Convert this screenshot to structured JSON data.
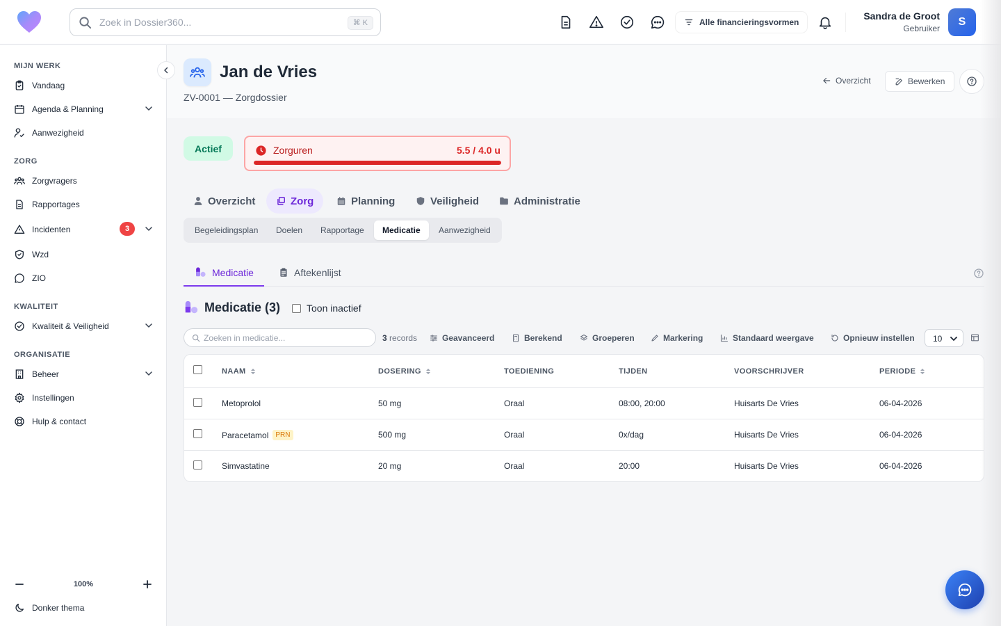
{
  "topbar": {
    "search_placeholder": "Zoek in Dossier360...",
    "search_shortcut": "⌘ K",
    "financing_label": "Alle financieringsvormen",
    "user_name": "Sandra de Groot",
    "user_role": "Gebruiker",
    "avatar_initial": "S"
  },
  "sidebar": {
    "sections": [
      {
        "title": "MIJN WERK",
        "items": [
          {
            "label": "Vandaag",
            "icon": "clipboard-check-icon"
          },
          {
            "label": "Agenda & Planning",
            "icon": "calendar-icon",
            "expandable": true
          },
          {
            "label": "Aanwezigheid",
            "icon": "user-check-icon"
          }
        ]
      },
      {
        "title": "ZORG",
        "items": [
          {
            "label": "Zorgvragers",
            "icon": "users-icon"
          },
          {
            "label": "Rapportages",
            "icon": "document-icon"
          },
          {
            "label": "Incidenten",
            "icon": "warning-icon",
            "badge": "3",
            "expandable": true
          },
          {
            "label": "Wzd",
            "icon": "shield-check-icon"
          },
          {
            "label": "ZIO",
            "icon": "chat-icon"
          }
        ]
      },
      {
        "title": "KWALITEIT",
        "items": [
          {
            "label": "Kwaliteit & Veiligheid",
            "icon": "check-circle-icon",
            "expandable": true
          }
        ]
      },
      {
        "title": "ORGANISATIE",
        "items": [
          {
            "label": "Beheer",
            "icon": "building-icon",
            "expandable": true
          },
          {
            "label": "Instellingen",
            "icon": "gear-icon"
          },
          {
            "label": "Hulp & contact",
            "icon": "lifebuoy-icon"
          }
        ]
      }
    ],
    "zoom_value": "100%",
    "theme_label": "Donker thema"
  },
  "header": {
    "title": "Jan de Vries",
    "subtitle": "ZV-0001 — Zorgdossier",
    "back_label": "Overzicht",
    "edit_label": "Bewerken"
  },
  "status": {
    "state_label": "Actief",
    "zorguren_label": "Zorguren",
    "zorguren_value": "5.5 / 4.0 u",
    "zorguren_progress": 1.0
  },
  "main_tabs": [
    {
      "label": "Overzicht",
      "icon": "user-icon",
      "active": false
    },
    {
      "label": "Zorg",
      "icon": "layers-icon",
      "active": true
    },
    {
      "label": "Planning",
      "icon": "calendar-icon",
      "active": false
    },
    {
      "label": "Veiligheid",
      "icon": "shield-icon",
      "active": false
    },
    {
      "label": "Administratie",
      "icon": "folder-icon",
      "active": false
    }
  ],
  "sub_tabs": [
    {
      "label": "Begeleidingsplan",
      "active": false
    },
    {
      "label": "Doelen",
      "active": false
    },
    {
      "label": "Rapportage",
      "active": false
    },
    {
      "label": "Medicatie",
      "active": true
    },
    {
      "label": "Aanwezigheid",
      "active": false
    }
  ],
  "inner_tabs": [
    {
      "label": "Medicatie",
      "icon": "pills-icon",
      "active": true
    },
    {
      "label": "Aftekenlijst",
      "icon": "clipboard-icon",
      "active": false
    }
  ],
  "section": {
    "title": "Medicatie (3)",
    "toggle_label": "Toon inactief"
  },
  "toolbar": {
    "search_placeholder": "Zoeken in medicatie...",
    "records_count": "3",
    "records_label": "records",
    "advanced": "Geavanceerd",
    "computed": "Berekend",
    "group": "Groeperen",
    "marking": "Markering",
    "default_view": "Standaard weergave",
    "reset": "Opnieuw instellen",
    "per_page": "10"
  },
  "table": {
    "columns": [
      "NAAM",
      "DOSERING",
      "TOEDIENING",
      "TIJDEN",
      "VOORSCHRIJVER",
      "PERIODE"
    ],
    "rows": [
      {
        "naam": "Metoprolol",
        "tag": "",
        "dosering": "50 mg",
        "toediening": "Oraal",
        "tijden": "08:00, 20:00",
        "voorschrijver": "Huisarts De Vries",
        "periode": "06-04-2026"
      },
      {
        "naam": "Paracetamol",
        "tag": "PRN",
        "dosering": "500 mg",
        "toediening": "Oraal",
        "tijden": "0x/dag",
        "voorschrijver": "Huisarts De Vries",
        "periode": "06-04-2026"
      },
      {
        "naam": "Simvastatine",
        "tag": "",
        "dosering": "20 mg",
        "toediening": "Oraal",
        "tijden": "20:00",
        "voorschrijver": "Huisarts De Vries",
        "periode": "06-04-2026"
      }
    ]
  },
  "colors": {
    "accent": "#6d28d9",
    "danger": "#dc2626",
    "success": "#047857"
  }
}
